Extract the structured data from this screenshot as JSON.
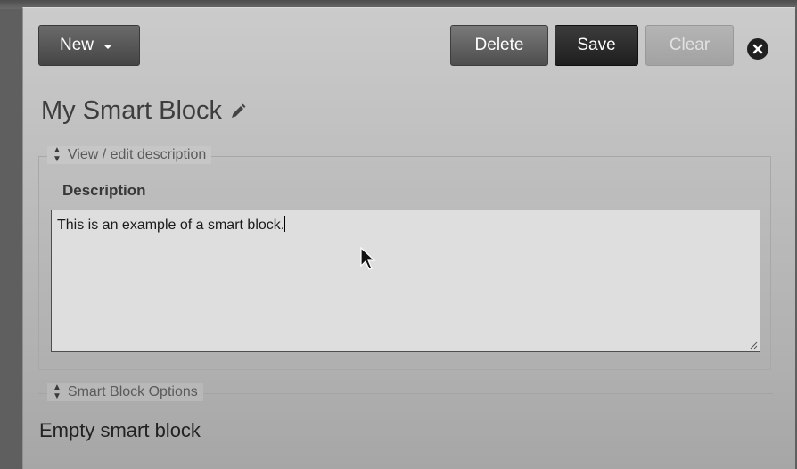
{
  "toolbar": {
    "new_label": "New",
    "delete_label": "Delete",
    "save_label": "Save",
    "clear_label": "Clear"
  },
  "block": {
    "title": "My Smart Block"
  },
  "description_section": {
    "legend": "View / edit description",
    "label": "Description",
    "value": "This is an example of a smart block."
  },
  "options_section": {
    "legend": "Smart Block Options",
    "status": "Empty smart block"
  },
  "icons": {
    "close": "close-icon",
    "edit": "pencil-icon",
    "toggle": "up-down-arrows-icon",
    "dropdown": "caret-down-icon"
  },
  "colors": {
    "save_button": "#2a2a2a",
    "panel_background": "#c2c2c2",
    "textarea_background": "#dedede"
  }
}
